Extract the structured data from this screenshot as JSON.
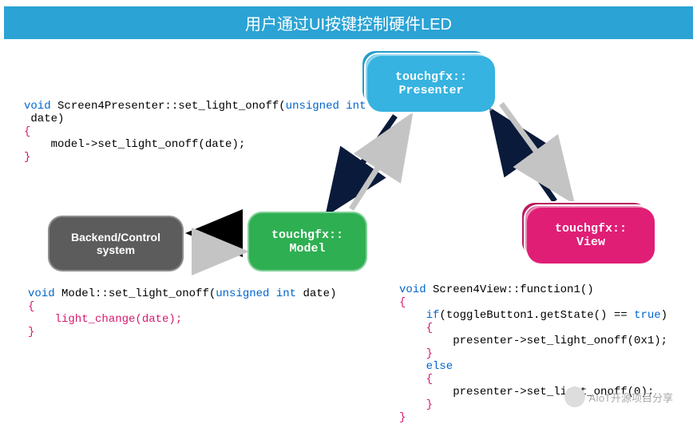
{
  "title": "用户通过UI按键控制硬件LED",
  "boxes": {
    "presenter": "touchgfx::\nPresenter",
    "backend": "Backend/Control\nsystem",
    "model": "touchgfx::\nModel",
    "view": "touchgfx::\nView"
  },
  "code": {
    "presenter": {
      "line1_kw": "void",
      "line1_rest": " Screen4Presenter::set_light_onoff(",
      "line1_kw2": "unsigned int",
      "line1_rest2": "\n date)",
      "brace_open": "{",
      "body": "    model->set_light_onoff(date);",
      "brace_close": "}"
    },
    "model": {
      "line1_kw": "void",
      "line1_rest": " Model::set_light_onoff(",
      "line1_kw2": "unsigned int",
      "line1_rest2": " date)",
      "brace_open": "{",
      "body": "    light_change(date);",
      "brace_close": "}"
    },
    "view": {
      "line1_kw": "void",
      "line1_rest": " Screen4View::function1()",
      "brace_open": "{",
      "if_kw": "    if",
      "if_rest": "(toggleButton1.getState() == ",
      "if_kw2": "true",
      "if_rest2": ")",
      "brace2": "    {",
      "body1": "        presenter->set_light_onoff(0x1);",
      "brace3": "    }",
      "else_kw": "    else",
      "brace4": "    {",
      "body2_a": "        presen",
      "body2_b": "ter->set_light_onoff(0);",
      "brace5": "    }",
      "brace_close": "}"
    }
  },
  "watermark": "AIoT开源项目分享"
}
